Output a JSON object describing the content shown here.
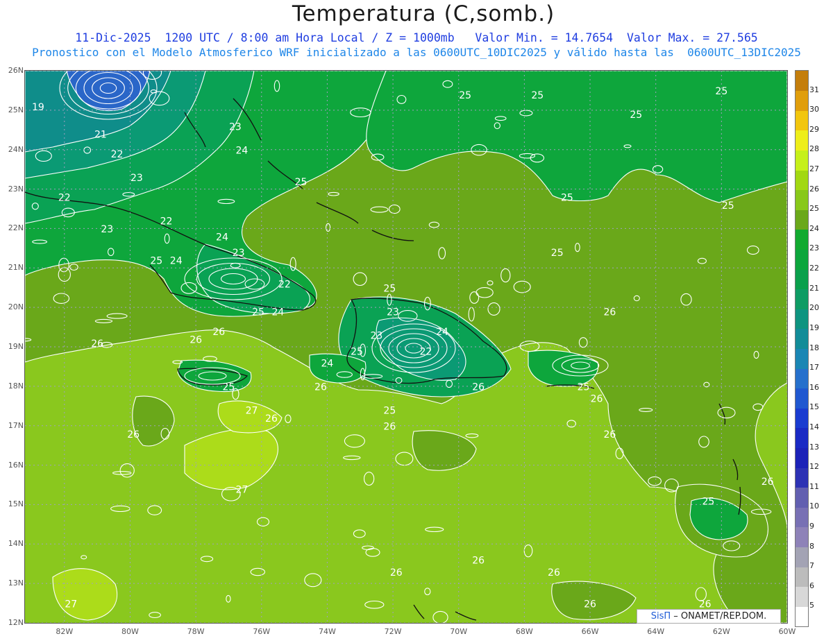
{
  "header": {
    "title": "Temperatura (C,somb.)",
    "line1": "11-Dic-2025  1200 UTC / 8:00 am Hora Local / Z = 1000mb   Valor Min. = 14.7654  Valor Max. = 27.565",
    "line2": "Pronostico con el Modelo Atmosferico WRF inicializado a las 0600UTC_10DIC2025 y válido hasta las  0600UTC_13DIC2025"
  },
  "map": {
    "lat_labels": [
      "26N",
      "25N",
      "24N",
      "23N",
      "22N",
      "21N",
      "20N",
      "19N",
      "18N",
      "17N",
      "16N",
      "15N",
      "14N",
      "13N",
      "12N"
    ],
    "lon_labels": [
      "82W",
      "80W",
      "78W",
      "76W",
      "74W",
      "72W",
      "70W",
      "68W",
      "66W",
      "64W",
      "62W",
      "60W"
    ],
    "contour_labels": [
      {
        "text": "19",
        "lat": 25.0,
        "lon": -82.8
      },
      {
        "text": "21",
        "lat": 24.3,
        "lon": -80.9
      },
      {
        "text": "22",
        "lat": 23.8,
        "lon": -80.4
      },
      {
        "text": "23",
        "lat": 23.2,
        "lon": -79.8
      },
      {
        "text": "22",
        "lat": 22.7,
        "lon": -82.0
      },
      {
        "text": "22",
        "lat": 22.1,
        "lon": -78.9
      },
      {
        "text": "23",
        "lat": 21.9,
        "lon": -80.7
      },
      {
        "text": "24",
        "lat": 21.7,
        "lon": -77.2
      },
      {
        "text": "24",
        "lat": 21.1,
        "lon": -78.6
      },
      {
        "text": "25",
        "lat": 21.1,
        "lon": -79.2
      },
      {
        "text": "23",
        "lat": 21.3,
        "lon": -76.7
      },
      {
        "text": "22",
        "lat": 20.5,
        "lon": -75.3
      },
      {
        "text": "25",
        "lat": 19.8,
        "lon": -76.1
      },
      {
        "text": "24",
        "lat": 19.8,
        "lon": -75.5
      },
      {
        "text": "23",
        "lat": 24.5,
        "lon": -76.8
      },
      {
        "text": "24",
        "lat": 23.9,
        "lon": -76.6
      },
      {
        "text": "25",
        "lat": 23.1,
        "lon": -74.8
      },
      {
        "text": "25",
        "lat": 25.3,
        "lon": -69.8
      },
      {
        "text": "25",
        "lat": 25.3,
        "lon": -67.6
      },
      {
        "text": "25",
        "lat": 25.4,
        "lon": -62.0
      },
      {
        "text": "25",
        "lat": 24.8,
        "lon": -64.6
      },
      {
        "text": "25",
        "lat": 22.7,
        "lon": -66.7
      },
      {
        "text": "25",
        "lat": 22.5,
        "lon": -61.8
      },
      {
        "text": "25",
        "lat": 21.3,
        "lon": -67.0
      },
      {
        "text": "25",
        "lat": 20.4,
        "lon": -72.1
      },
      {
        "text": "23",
        "lat": 19.8,
        "lon": -72.0
      },
      {
        "text": "23",
        "lat": 19.2,
        "lon": -72.5
      },
      {
        "text": "24",
        "lat": 19.3,
        "lon": -70.5
      },
      {
        "text": "22",
        "lat": 18.8,
        "lon": -71.0
      },
      {
        "text": "24",
        "lat": 18.5,
        "lon": -74.0
      },
      {
        "text": "25",
        "lat": 18.8,
        "lon": -73.1
      },
      {
        "text": "26",
        "lat": 19.0,
        "lon": -81.0
      },
      {
        "text": "26",
        "lat": 19.1,
        "lon": -78.0
      },
      {
        "text": "26",
        "lat": 19.3,
        "lon": -77.3
      },
      {
        "text": "25",
        "lat": 17.9,
        "lon": -77.0
      },
      {
        "text": "26",
        "lat": 17.9,
        "lon": -74.2
      },
      {
        "text": "25",
        "lat": 17.3,
        "lon": -72.1
      },
      {
        "text": "26",
        "lat": 17.9,
        "lon": -69.4
      },
      {
        "text": "26",
        "lat": 16.9,
        "lon": -72.1
      },
      {
        "text": "26",
        "lat": 17.6,
        "lon": -65.8
      },
      {
        "text": "25",
        "lat": 17.9,
        "lon": -66.2
      },
      {
        "text": "26",
        "lat": 19.8,
        "lon": -65.4
      },
      {
        "text": "26",
        "lat": 16.7,
        "lon": -65.4
      },
      {
        "text": "27",
        "lat": 17.3,
        "lon": -76.3
      },
      {
        "text": "26",
        "lat": 17.1,
        "lon": -75.7
      },
      {
        "text": "26",
        "lat": 16.7,
        "lon": -79.9
      },
      {
        "text": "27",
        "lat": 15.3,
        "lon": -76.6
      },
      {
        "text": "26",
        "lat": 15.5,
        "lon": -60.6
      },
      {
        "text": "25",
        "lat": 15.0,
        "lon": -62.4
      },
      {
        "text": "26",
        "lat": 13.5,
        "lon": -69.4
      },
      {
        "text": "26",
        "lat": 13.2,
        "lon": -67.1
      },
      {
        "text": "26",
        "lat": 13.2,
        "lon": -71.9
      },
      {
        "text": "26",
        "lat": 12.4,
        "lon": -66.0
      },
      {
        "text": "26",
        "lat": 12.4,
        "lon": -62.5
      },
      {
        "text": "27",
        "lat": 12.4,
        "lon": -81.8
      }
    ]
  },
  "colorbar": {
    "levels": [
      "5",
      "6",
      "7",
      "8",
      "9",
      "10",
      "11",
      "12",
      "13",
      "14",
      "15",
      "16",
      "17",
      "18",
      "19",
      "20",
      "21",
      "22",
      "23",
      "24",
      "25",
      "26",
      "27",
      "28",
      "29",
      "30",
      "31"
    ],
    "colors": [
      "#ffffff",
      "#d8d8d8",
      "#bcbcbc",
      "#a3a3b4",
      "#8e82b8",
      "#7870b4",
      "#625fb0",
      "#2d32b4",
      "#1c22b8",
      "#1a2ac4",
      "#1a3cd0",
      "#2058d0",
      "#2670cc",
      "#1a86b4",
      "#128c98",
      "#0e9480",
      "#0e9c64",
      "#0aa04c",
      "#0ca63c",
      "#12aa30",
      "#6aa81a",
      "#88c81a",
      "#a2d812",
      "#c6f01a",
      "#eeee1a",
      "#f2c60e",
      "#e09e0c",
      "#c47e0c"
    ],
    "field_colors": {
      "19": "#2a66c8",
      "21": "#0f8d8a",
      "22": "#0b9a74",
      "23": "#0aa254",
      "24": "#0ea63c",
      "25": "#6aa81a",
      "26": "#8ac81e",
      "27": "#acdc1a"
    }
  },
  "credit": {
    "brand": "SisΠ",
    "text": " – ONAMET/REP.DOM."
  }
}
